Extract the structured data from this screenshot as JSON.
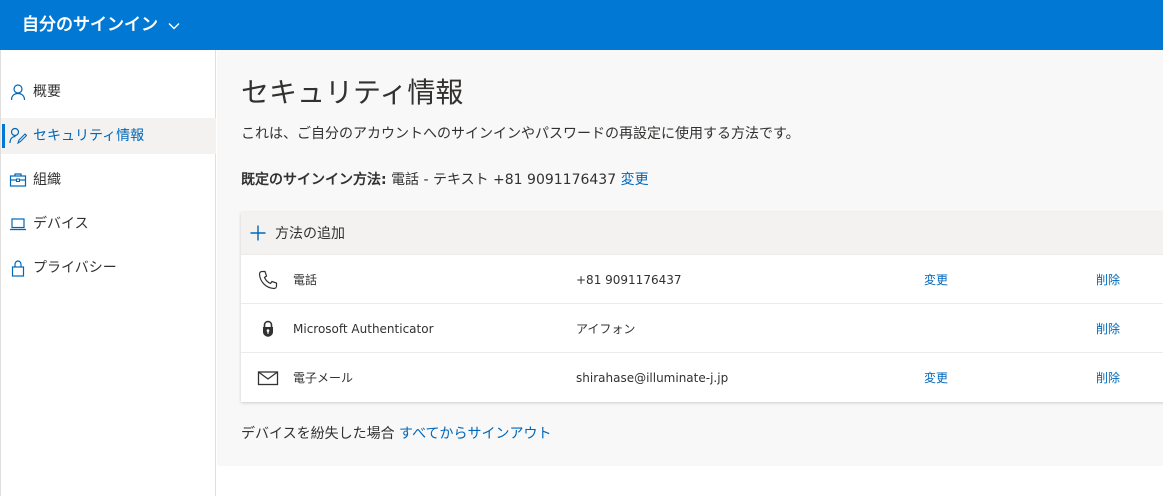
{
  "header": {
    "title": "自分のサインイン"
  },
  "sidebar": {
    "items": [
      {
        "label": "概要",
        "icon": "person-icon"
      },
      {
        "label": "セキュリティ情報",
        "icon": "security-info-icon",
        "active": true
      },
      {
        "label": "組織",
        "icon": "briefcase-icon"
      },
      {
        "label": "デバイス",
        "icon": "laptop-icon"
      },
      {
        "label": "プライバシー",
        "icon": "lock-icon"
      }
    ]
  },
  "main": {
    "title": "セキュリティ情報",
    "subtitle": "これは、ご自分のアカウントへのサインインやパスワードの再設定に使用する方法です。",
    "default_method": {
      "label": "既定のサインイン方法:",
      "value": "電話 - テキスト +81 9091176437",
      "change_link": "変更"
    },
    "add_method": {
      "label": "方法の追加"
    },
    "methods": [
      {
        "name": "電話",
        "detail": "+81 9091176437",
        "change": "変更",
        "delete": "削除",
        "icon": "phone-icon"
      },
      {
        "name": "Microsoft Authenticator",
        "detail": "アイフォン",
        "change": "",
        "delete": "削除",
        "icon": "authenticator-icon"
      },
      {
        "name": "電子メール",
        "detail": "shirahase@illuminate-j.jp",
        "change": "変更",
        "delete": "削除",
        "icon": "mail-icon"
      }
    ],
    "lost_device": {
      "text": "デバイスを紛失した場合",
      "link": "すべてからサインアウト"
    }
  },
  "colors": {
    "accent": "#0078d4",
    "link": "#0067b8",
    "background": "#f8f8f8"
  }
}
